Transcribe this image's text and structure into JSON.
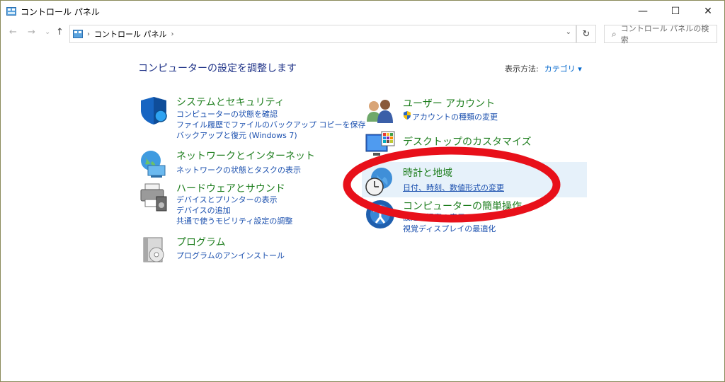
{
  "window": {
    "title": "コントロール パネル",
    "controls": {
      "minimize": "—",
      "maximize": "☐",
      "close": "✕"
    }
  },
  "nav": {
    "back": "←",
    "forward": "→",
    "dropdown": "⌄",
    "up": "↑",
    "breadcrumb_sep": "›",
    "breadcrumb": "コントロール パネル",
    "breadcrumb_sep2": "›",
    "addr_dd": "⌄",
    "refresh": "↻",
    "search_placeholder": "コントロール パネルの検索"
  },
  "main": {
    "heading": "コンピューターの設定を調整します",
    "view_by_label": "表示方法:",
    "view_by_value": "カテゴリ ▾"
  },
  "categories_left": [
    {
      "title": "システムとセキュリティ",
      "links": [
        "コンピューターの状態を確認",
        "ファイル履歴でファイルのバックアップ コピーを保存",
        "バックアップと復元 (Windows 7)"
      ]
    },
    {
      "title": "ネットワークとインターネット",
      "links": [
        "ネットワークの状態とタスクの表示"
      ]
    },
    {
      "title": "ハードウェアとサウンド",
      "links": [
        "デバイスとプリンターの表示",
        "デバイスの追加",
        "共通で使うモビリティ設定の調整"
      ]
    },
    {
      "title": "プログラム",
      "links": [
        "プログラムのアンインストール"
      ]
    }
  ],
  "categories_right": [
    {
      "title": "ユーザー アカウント",
      "links": [
        "アカウントの種類の変更"
      ]
    },
    {
      "title": "デスクトップのカスタマイズ",
      "links": []
    },
    {
      "title": "時計と地域",
      "links": [
        "日付、時刻、数値形式の変更"
      ]
    },
    {
      "title": "コンピューターの簡単操作",
      "links": [
        "設定の提案の表示",
        "視覚ディスプレイの最適化"
      ]
    }
  ],
  "colors": {
    "accent": "#0066cc",
    "title_green": "#1e7e1e",
    "heading_blue": "#1e3287",
    "annotation_red": "#e8101a",
    "highlight": "#e6f1fa"
  }
}
